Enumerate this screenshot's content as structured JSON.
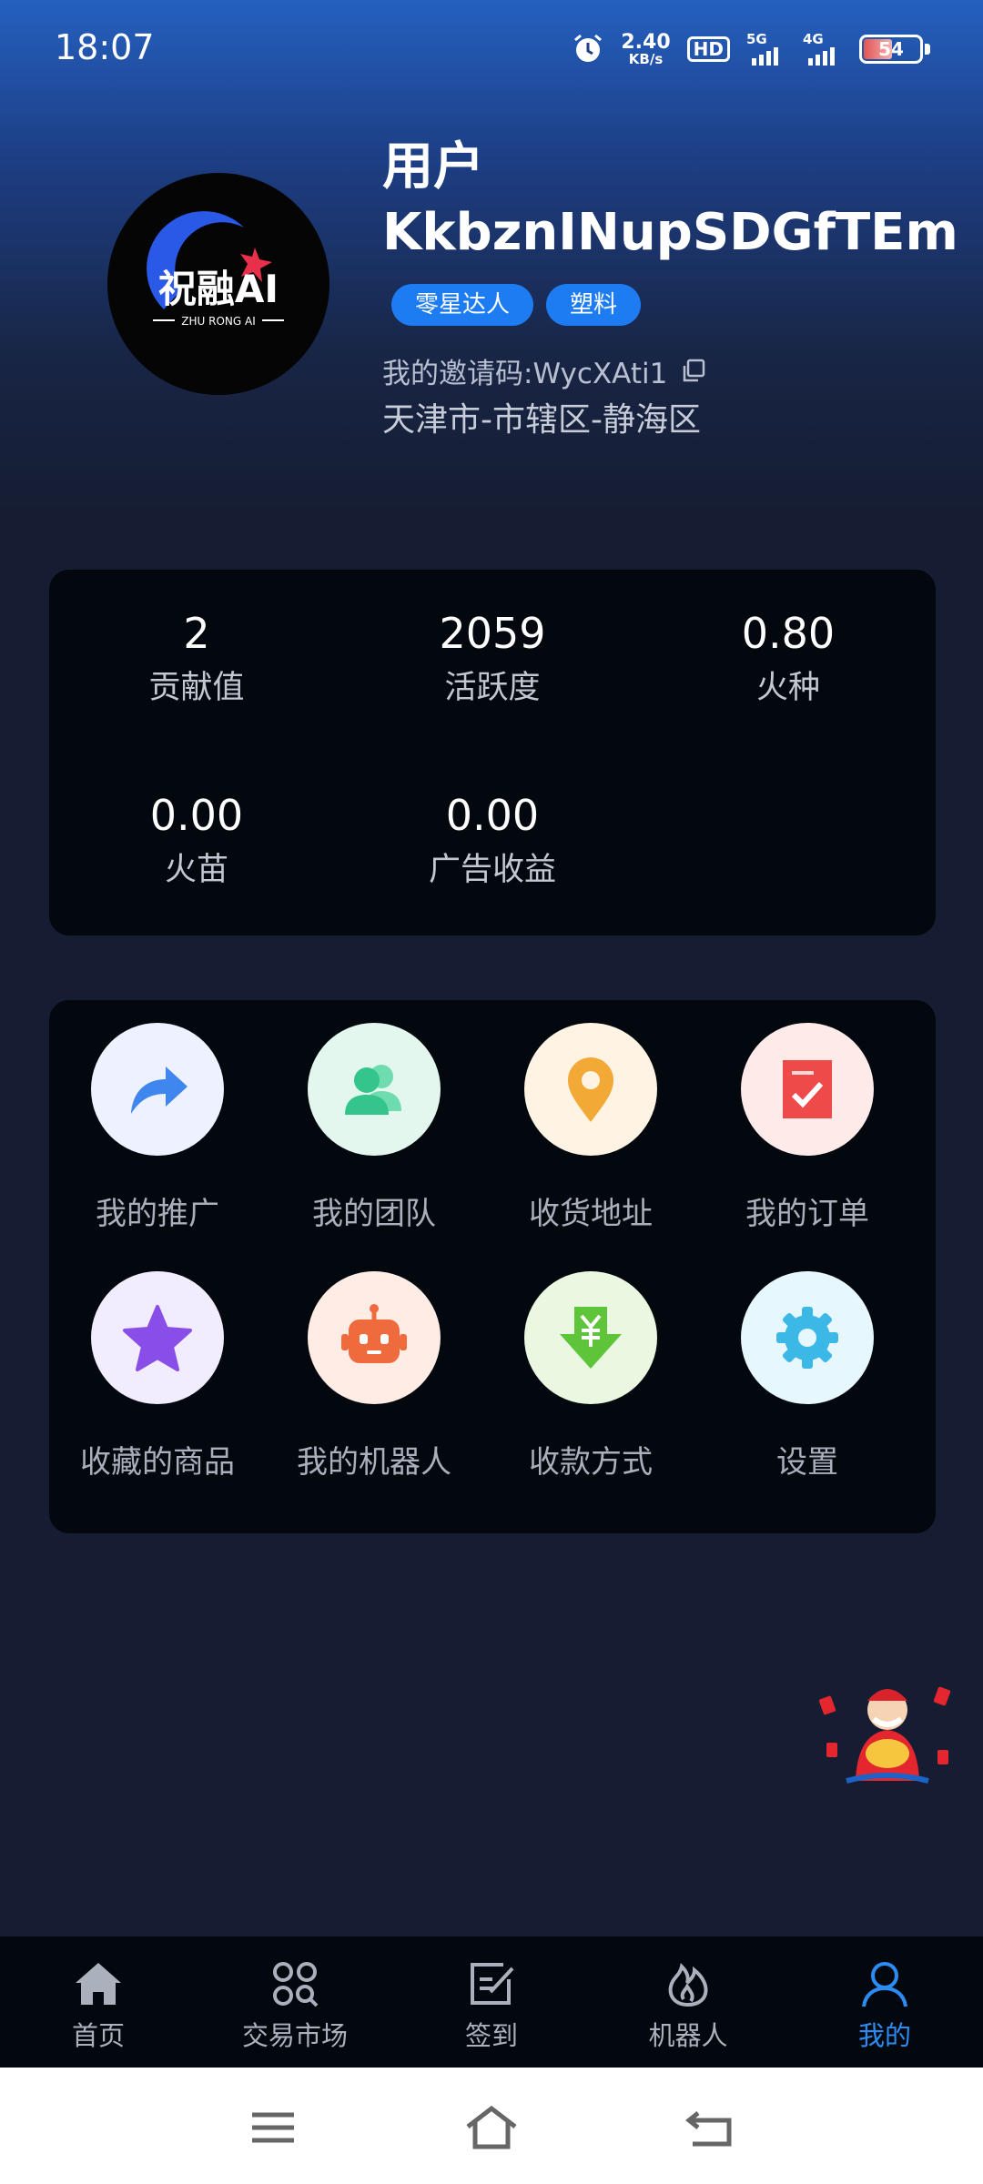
{
  "status_bar": {
    "time": "18:07",
    "net_speed_value": "2.40",
    "net_speed_unit": "KB/s",
    "hd_label": "HD",
    "sim1_label": "5G",
    "sim2_label": "4G",
    "battery_percent": 54
  },
  "profile": {
    "avatar_logo_text": "祝融AI",
    "avatar_logo_subtext": "ZHU RONG AI",
    "username": "用户KkbznINupSDGfTEm",
    "tags": [
      "零星达人",
      "塑料"
    ],
    "invite_code": "我的邀请码:WycXAti1",
    "location": "天津市-市辖区-静海区"
  },
  "stats": [
    {
      "value": "2",
      "label": "贡献值"
    },
    {
      "value": "2059",
      "label": "活跃度"
    },
    {
      "value": "0.80",
      "label": "火种"
    },
    {
      "value": "0.00",
      "label": "火苗"
    },
    {
      "value": "0.00",
      "label": "广告收益"
    }
  ],
  "menu": [
    {
      "label": "我的推广",
      "icon": "share-arrow-icon",
      "bg": "#eef1ff",
      "color": "#3f86ee"
    },
    {
      "label": "我的团队",
      "icon": "team-icon",
      "bg": "#e3f7ee",
      "color": "#34c58b"
    },
    {
      "label": "收货地址",
      "icon": "location-pin-icon",
      "bg": "#fff4e3",
      "color": "#f2a935"
    },
    {
      "label": "我的订单",
      "icon": "order-icon",
      "bg": "#ffeaea",
      "color": "#ef4a4a"
    },
    {
      "label": "收藏的商品",
      "icon": "star-icon",
      "bg": "#f2ecff",
      "color": "#8a4ee8"
    },
    {
      "label": "我的机器人",
      "icon": "robot-icon",
      "bg": "#ffece4",
      "color": "#ef6a3c"
    },
    {
      "label": "收款方式",
      "icon": "yuan-download-icon",
      "bg": "#eaf8e2",
      "color": "#5ec43a"
    },
    {
      "label": "设置",
      "icon": "gear-icon",
      "bg": "#e6f7fd",
      "color": "#3cb8e6"
    }
  ],
  "tab_bar": [
    {
      "label": "首页",
      "icon": "home-icon",
      "active": false
    },
    {
      "label": "交易市场",
      "icon": "market-icon",
      "active": false
    },
    {
      "label": "签到",
      "icon": "checkin-icon",
      "active": false
    },
    {
      "label": "机器人",
      "icon": "flame-icon",
      "active": false
    },
    {
      "label": "我的",
      "icon": "user-icon",
      "active": true
    }
  ],
  "colors": {
    "accent": "#2c8cf6",
    "tag_bg": "#1e7cf2",
    "card_bg": "#03070e",
    "page_bg": "#161d33"
  }
}
